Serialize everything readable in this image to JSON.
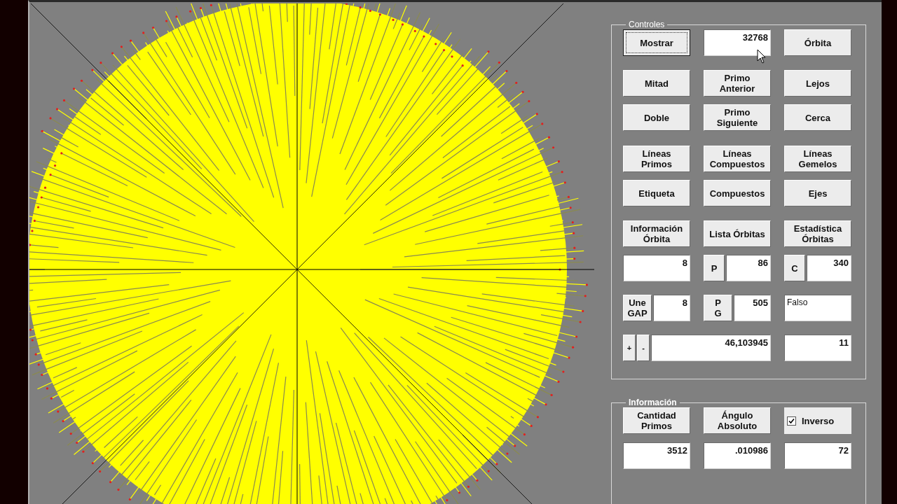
{
  "controls": {
    "legend": "Controles",
    "bold": false,
    "rows": [
      [
        {
          "kind": "button",
          "label": "Mostrar",
          "focused": true
        },
        {
          "kind": "field",
          "value": "32768"
        },
        {
          "kind": "button",
          "label": "Órbita",
          "focused": false
        }
      ],
      [
        {
          "kind": "button",
          "label": "Mitad",
          "focused": false
        },
        {
          "kind": "button",
          "label": "Primo\nAnterior",
          "focused": false
        },
        {
          "kind": "button",
          "label": "Lejos",
          "focused": false
        }
      ],
      [
        {
          "kind": "button",
          "label": "Doble",
          "focused": false
        },
        {
          "kind": "button",
          "label": "Primo\nSiguiente",
          "focused": false
        },
        {
          "kind": "button",
          "label": "Cerca",
          "focused": false
        }
      ],
      [
        {
          "kind": "button",
          "label": "Líneas\nPrimos",
          "focused": false
        },
        {
          "kind": "button",
          "label": "Líneas\nCompuestos",
          "focused": false
        },
        {
          "kind": "button",
          "label": "Líneas\nGemelos",
          "focused": false
        }
      ],
      [
        {
          "kind": "button",
          "label": "Etiqueta",
          "focused": false
        },
        {
          "kind": "button",
          "label": "Compuestos",
          "focused": false
        },
        {
          "kind": "button",
          "label": "Ejes",
          "focused": false
        }
      ],
      [
        {
          "kind": "button",
          "label": "Información\nÓrbita",
          "focused": false
        },
        {
          "kind": "button",
          "label": "Lista Órbitas",
          "focused": false
        },
        {
          "kind": "button",
          "label": "Estadística\nÓrbitas",
          "focused": false
        }
      ],
      [
        {
          "kind": "field",
          "value": "8"
        },
        {
          "kind": "labeled",
          "label": "P",
          "value": "86"
        },
        {
          "kind": "labeled",
          "label": "C",
          "value": "340"
        }
      ],
      [
        {
          "kind": "labeled",
          "label": "Une\nGAP",
          "value": "8"
        },
        {
          "kind": "labeled",
          "label": "P\nG",
          "value": "505"
        },
        {
          "kind": "text_field",
          "value": "Falso"
        }
      ],
      [
        {
          "kind": "stepper",
          "plus": "+",
          "minus": "-",
          "value": "46,103945"
        },
        {
          "kind": "field",
          "value": "11"
        }
      ]
    ]
  },
  "information": {
    "legend": "Información",
    "bold": true,
    "rows": [
      [
        {
          "kind": "button",
          "label": "Cantidad\nPrimos",
          "focused": false
        },
        {
          "kind": "button",
          "label": "Ángulo\nAbsoluto",
          "focused": false
        },
        {
          "kind": "checkbox",
          "label": "Inverso",
          "checked": true
        }
      ],
      [
        {
          "kind": "field",
          "value": "3512"
        },
        {
          "kind": "field",
          "value": ".010986"
        },
        {
          "kind": "field",
          "value": "72"
        }
      ]
    ]
  }
}
